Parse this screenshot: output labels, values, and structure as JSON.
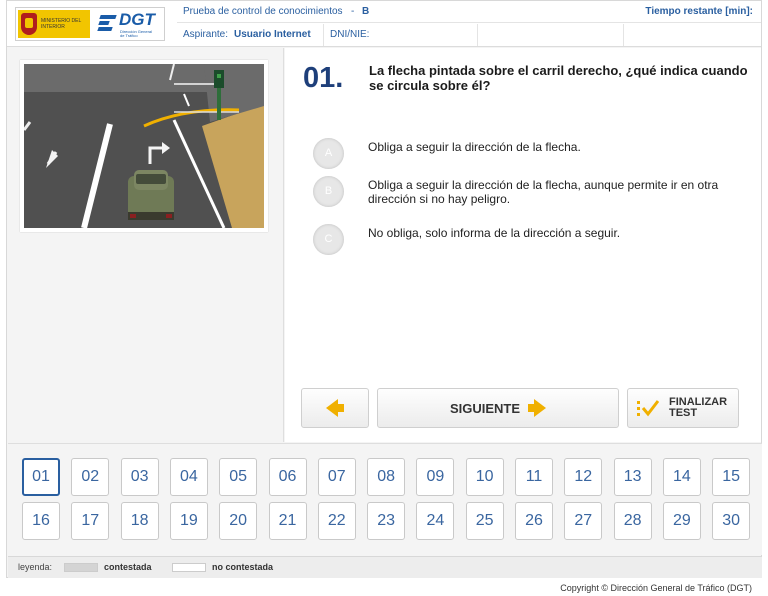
{
  "header": {
    "logo_ministry_text": "MINISTERIO DEL INTERIOR",
    "logo_dgt_text": "DGT",
    "logo_dgt_sub": "Dirección General de Tráfico",
    "exam_label": "Prueba de control de conocimientos",
    "exam_dash": "-",
    "exam_type": "B",
    "time_label": "Tiempo restante [min]:",
    "applicant_label": "Aspirante:",
    "applicant_value": "Usuario Internet",
    "dni_label": "DNI/NIE:"
  },
  "question": {
    "number": "01.",
    "text": "La flecha pintada sobre el carril derecho, ¿qué indica cuando se circula sobre él?",
    "options": [
      {
        "letter": "A",
        "text": "Obliga a seguir la dirección de la flecha."
      },
      {
        "letter": "B",
        "text": "Obliga a seguir la dirección de la flecha, aunque permite ir en otra dirección si no hay peligro."
      },
      {
        "letter": "C",
        "text": "No obliga, solo informa de la dirección a seguir."
      }
    ]
  },
  "nav": {
    "next_label": "SIGUIENTE",
    "finish_label": "FINALIZAR TEST"
  },
  "questions_grid": {
    "current": "01",
    "numbers": [
      "01",
      "02",
      "03",
      "04",
      "05",
      "06",
      "07",
      "08",
      "09",
      "10",
      "11",
      "12",
      "13",
      "14",
      "15",
      "16",
      "17",
      "18",
      "19",
      "20",
      "21",
      "22",
      "23",
      "24",
      "25",
      "26",
      "27",
      "28",
      "29",
      "30"
    ]
  },
  "legend": {
    "label": "leyenda:",
    "answered": "contestada",
    "unanswered": "no contestada"
  },
  "footer": {
    "copyright": "Copyright © Dirección General de Tráfico (DGT)"
  },
  "colors": {
    "accent": "#2a5fa0",
    "arrow": "#f0b000",
    "ministry": "#f2c500"
  }
}
